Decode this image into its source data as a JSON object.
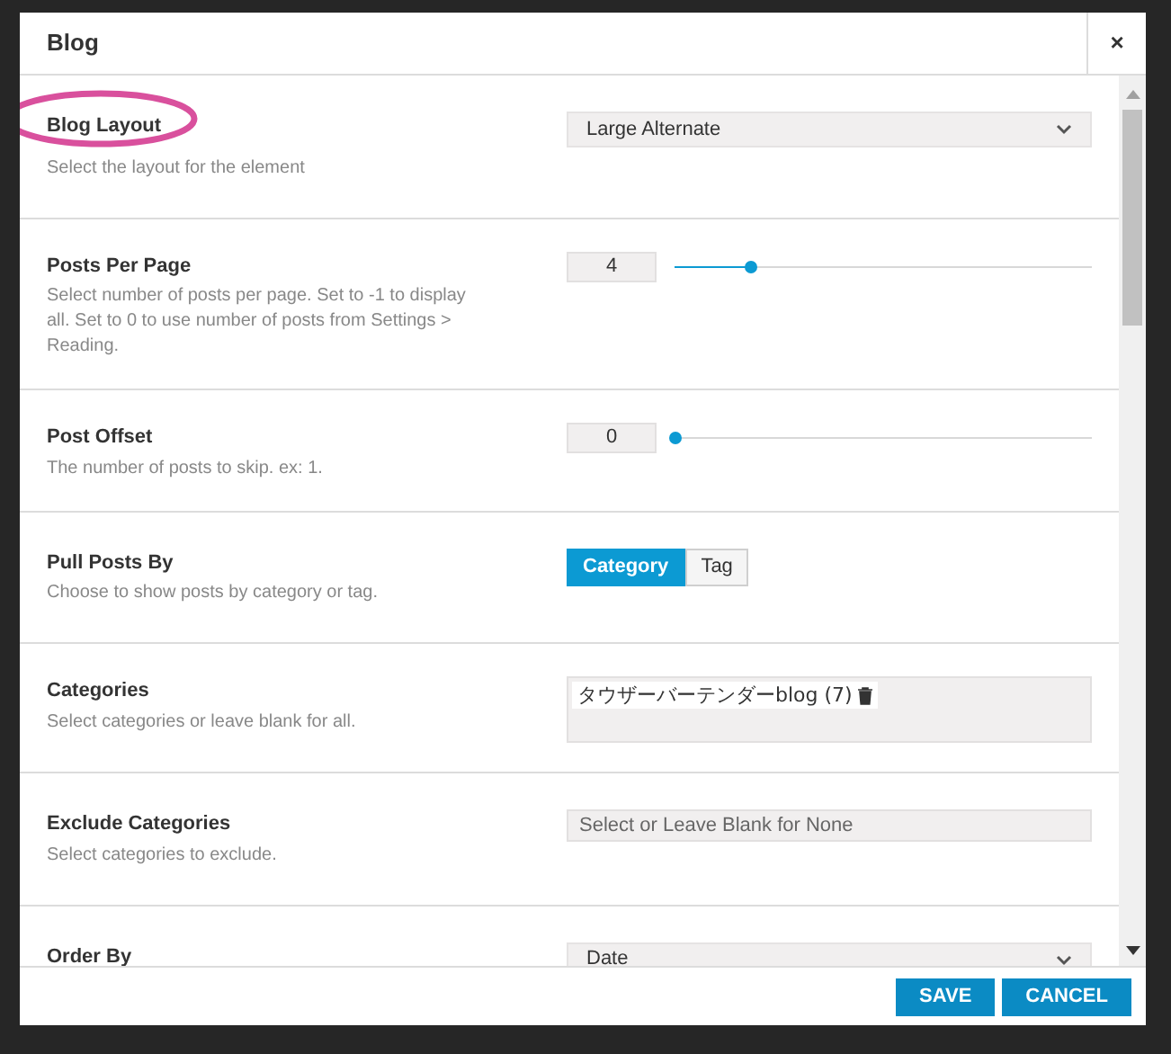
{
  "dialog": {
    "title": "Blog",
    "close": "×"
  },
  "rows": [
    {
      "kind": "select",
      "label": "Blog Layout",
      "description": "Select the layout for the element",
      "value": "Large Alternate",
      "highlighted": true
    },
    {
      "kind": "slider",
      "label": "Posts Per Page",
      "description": "Select number of posts per page. Set to -1 to display all. Set to 0 to use number of posts from Settings > Reading.",
      "value": "4",
      "level": 0.18
    },
    {
      "kind": "slider",
      "label": "Post Offset",
      "description": "The number of posts to skip. ex: 1.",
      "value": "0",
      "level": 0
    },
    {
      "kind": "toggle",
      "label": "Pull Posts By",
      "description": "Choose to show posts by category or tag.",
      "options": [
        {
          "label": "Category",
          "selected": true
        },
        {
          "label": "Tag",
          "selected": false
        }
      ]
    },
    {
      "kind": "tags",
      "label": "Categories",
      "description": "Select categories or leave blank for all.",
      "tags": [
        "タウザーバーテンダーblog (7)"
      ]
    },
    {
      "kind": "multiselect",
      "label": "Exclude Categories",
      "description": "Select categories to exclude.",
      "placeholder": "Select or Leave Blank for None"
    },
    {
      "kind": "select",
      "label": "Order By",
      "value": "Date"
    }
  ],
  "buttons": [
    "SAVE",
    "CANCEL"
  ]
}
